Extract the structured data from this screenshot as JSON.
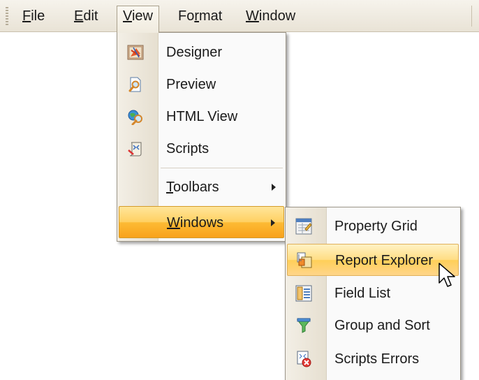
{
  "menubar": {
    "file": {
      "mnemonic": "F",
      "rest": "ile"
    },
    "edit": {
      "mnemonic": "E",
      "rest": "dit"
    },
    "view": {
      "mnemonic": "V",
      "rest": "iew"
    },
    "format": {
      "pre": "Fo",
      "mnemonic": "r",
      "rest": "mat"
    },
    "window": {
      "mnemonic": "W",
      "rest": "indow"
    }
  },
  "view_menu": {
    "designer": "Designer",
    "preview": "Preview",
    "html_view": "HTML View",
    "scripts": "Scripts",
    "toolbars": {
      "mnemonic": "T",
      "rest": "oolbars"
    },
    "windows": {
      "mnemonic": "W",
      "rest": "indows"
    }
  },
  "windows_submenu": {
    "property_grid": "Property Grid",
    "report_explorer": "Report Explorer",
    "field_list": "Field List",
    "group_and_sort": "Group and Sort",
    "scripts_errors": "Scripts Errors"
  },
  "icons": {
    "designer": "designer-icon",
    "preview": "preview-magnifier-icon",
    "html_view": "html-view-globe-icon",
    "scripts": "scripts-icon",
    "property_grid": "property-grid-icon",
    "report_explorer": "report-explorer-icon",
    "field_list": "field-list-icon",
    "group_and_sort": "group-sort-funnel-icon",
    "scripts_errors": "scripts-errors-icon"
  },
  "colors": {
    "highlight": "#fdbb35",
    "menubar": "#e9e3d6",
    "gutter": "#e6dfd0"
  }
}
